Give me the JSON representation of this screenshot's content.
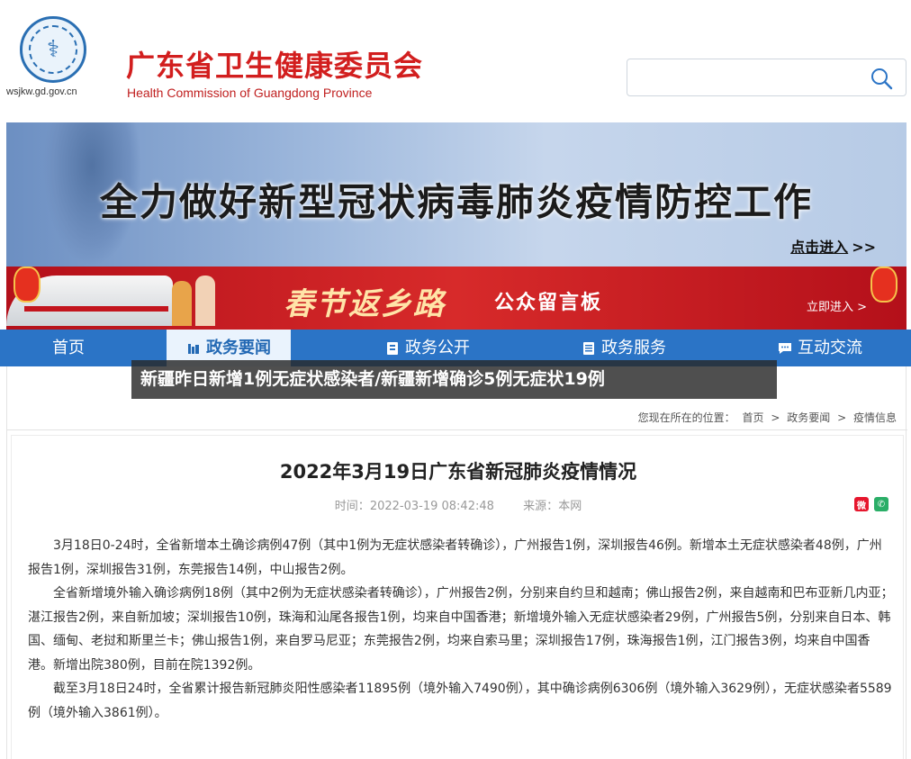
{
  "header": {
    "site_domain": "wsjkw.gd.gov.cn",
    "org_name_cn": "广东省卫生健康委员会",
    "org_name_en": "Health Commission of Guangdong Province",
    "search": {
      "placeholder": "",
      "icon": "search-icon"
    }
  },
  "banner_main": {
    "title": "全力做好新型冠状病毒肺炎疫情防控工作",
    "link": "点击进入",
    "link_arrows": ">>"
  },
  "banner_spring": {
    "title": "春节返乡路",
    "subtitle": "公众留言板",
    "link": "立即进入 >"
  },
  "nav": {
    "items": [
      {
        "label": "首页",
        "icon": ""
      },
      {
        "label": "政务要闻",
        "icon": "news-icon",
        "active": true
      },
      {
        "label": "政务公开",
        "icon": "document-icon"
      },
      {
        "label": "政务服务",
        "icon": "service-icon"
      },
      {
        "label": "互动交流",
        "icon": "chat-icon"
      }
    ]
  },
  "overlay_caption": "新疆昨日新增1例无症状感染者/新疆新增确诊5例无症状19例",
  "breadcrumb": {
    "prefix": "您现在所在的位置：",
    "items": [
      "首页",
      "政务要闻",
      "疫情信息"
    ],
    "separator": ">"
  },
  "article": {
    "title": "2022年3月19日广东省新冠肺炎疫情情况",
    "time_label": "时间：",
    "time": "2022-03-19 08:42:48",
    "source_label": "来源：",
    "source": "本网",
    "share": [
      "weibo-icon",
      "wechat-icon"
    ],
    "paragraphs": [
      "3月18日0-24时，全省新增本土确诊病例47例（其中1例为无症状感染者转确诊），广州报告1例，深圳报告46例。新增本土无症状感染者48例，广州报告1例，深圳报告31例，东莞报告14例，中山报告2例。",
      "全省新增境外输入确诊病例18例（其中2例为无症状感染者转确诊），广州报告2例，分别来自约旦和越南；佛山报告2例，来自越南和巴布亚新几内亚；湛江报告2例，来自新加坡；深圳报告10例，珠海和汕尾各报告1例，均来自中国香港；新增境外输入无症状感染者29例，广州报告5例，分别来自日本、韩国、缅甸、老挝和斯里兰卡；佛山报告1例，来自罗马尼亚；东莞报告2例，均来自索马里；深圳报告17例，珠海报告1例，江门报告3例，均来自中国香港。新增出院380例，目前在院1392例。",
      "截至3月18日24时，全省累计报告新冠肺炎阳性感染者11895例（境外输入7490例），其中确诊病例6306例（境外输入3629例），无症状感染者5589例（境外输入3861例）。"
    ]
  },
  "colors": {
    "brand_red": "#d21e1e",
    "nav_blue": "#2b74c6",
    "active_nav_bg": "#eaf3fd"
  }
}
